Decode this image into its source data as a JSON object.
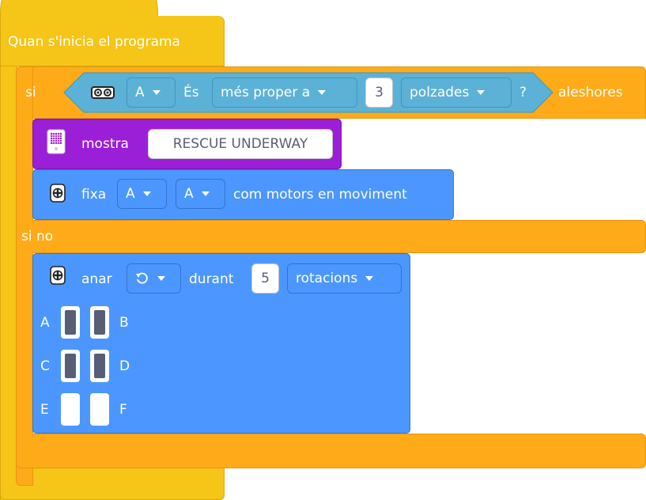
{
  "hat_block": {
    "label": "Quan s'inicia el programa"
  },
  "if_block": {
    "if_label": "si",
    "then_label": "aleshores",
    "else_label": "si no"
  },
  "condition": {
    "sensor_icon": "distance-sensor-icon",
    "port": "A",
    "is_label": "És",
    "comparison": "més proper a",
    "value": "3",
    "unit": "polzades",
    "question": "?"
  },
  "display_block": {
    "icon": "light-matrix-icon",
    "label": "mostra",
    "text": "RESCUE UNDERWAY"
  },
  "set_motor_block": {
    "icon": "motor-pair-icon",
    "label": "fixa",
    "port1": "A",
    "port2": "A",
    "suffix": "com motors en moviment"
  },
  "move_block": {
    "icon": "motor-pair-icon",
    "label": "anar",
    "direction_icon": "rotate-ccw-icon",
    "during_label": "durant",
    "amount": "5",
    "unit": "rotacions",
    "port_rows": [
      {
        "left": "A",
        "right": "B",
        "left_active": true,
        "right_active": true
      },
      {
        "left": "C",
        "right": "D",
        "left_active": true,
        "right_active": true
      },
      {
        "left": "E",
        "right": "F",
        "left_active": false,
        "right_active": false
      }
    ]
  },
  "colors": {
    "event": "#f5c518",
    "control": "#ffab19",
    "sensing": "#5cb1d6",
    "display": "#9b1fd6",
    "motor": "#4c97ff",
    "port_active": "#575e75"
  }
}
